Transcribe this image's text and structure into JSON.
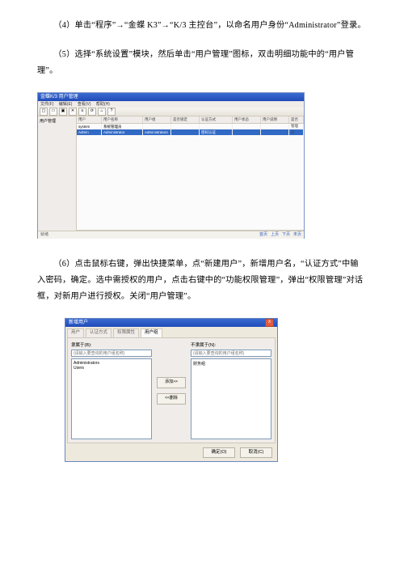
{
  "paragraphs": {
    "p4": "（4）单击“程序”→“金蝶 K3”→“K/3 主控台”，以命名用户身份“Administrator”登录。",
    "p5": "（5）选择“系统设置”模块，然后单击“用户管理”图标，双击明细功能中的“用户管理”。",
    "p6": "（6）点击鼠标右键，弹出快捷菜单，点“新建用户”，新增用户名，“认证方式”中输入密码，确定。选中需授权的用户，点击右键中的“功能权限管理”，弹出“权限管理”对话框，对新用户进行授权。关闭“用户管理”。"
  },
  "shot1": {
    "title": "金蝶K/3 用户管理",
    "menus": [
      "文件(F)",
      "编辑(E)",
      "查看(V)",
      "帮助(H)"
    ],
    "nav_root": "用户管理",
    "headers": [
      "用户",
      "用户名称",
      "用户组",
      "是否锁定",
      "认证方式",
      "用户状态",
      "用户说明",
      "是否管理员"
    ],
    "rows": [
      {
        "a": "system",
        "b": "系统管理员",
        "c": "",
        "d": "",
        "e": "",
        "f": "",
        "g": "",
        "h": ""
      },
      {
        "a": "Admin",
        "b": "Administrator",
        "c": "Administrators",
        "d": "",
        "e": "密码认证",
        "f": "",
        "g": "",
        "h": ""
      }
    ],
    "status_left": "就绪",
    "pager": [
      "首页",
      "上页",
      "下页",
      "末页"
    ]
  },
  "shot2": {
    "title": "新增用户",
    "close": "X",
    "tabs": [
      "用户",
      "认证方式",
      "权限属性",
      "用户组"
    ],
    "left": {
      "label1": "隶属于(B):",
      "hint": "(请输入要查询的用户组名称)",
      "items": [
        "Administrators",
        "Users"
      ]
    },
    "mid": {
      "add": "添加>>",
      "del": "<<删除"
    },
    "right": {
      "label1": "不隶属于(N):",
      "hint": "(请输入要查询的用户组名称)",
      "items": [
        "财务组"
      ]
    },
    "buttons": {
      "ok": "确定(O)",
      "cancel": "取消(C)"
    }
  }
}
